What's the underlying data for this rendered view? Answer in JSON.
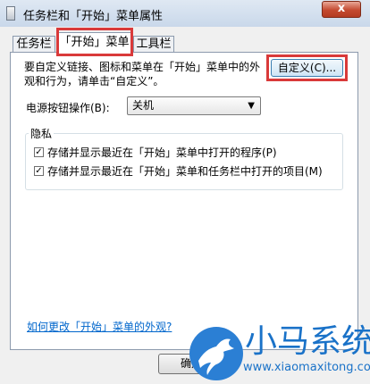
{
  "window": {
    "title": "任务栏和「开始」菜单属性",
    "close_label": "x"
  },
  "tabs": [
    {
      "label": "任务栏",
      "selected": false
    },
    {
      "label": "「开始」菜单",
      "selected": true
    },
    {
      "label": "工具栏",
      "selected": false
    }
  ],
  "start_menu": {
    "description": "要自定义链接、图标和菜单在「开始」菜单中的外观和行为，请单击“自定义”。",
    "customize_label": "自定义(C)...",
    "power_label": "电源按钮操作(B):",
    "power_value": "关机",
    "privacy": {
      "title": "隐私",
      "items": [
        {
          "label": "存储并显示最近在「开始」菜单中打开的程序(P)",
          "checked": true
        },
        {
          "label": "存储并显示最近在「开始」菜单和任务栏中打开的项目(M)",
          "checked": true
        }
      ]
    },
    "help_link": "如何更改「开始」菜单的外观?"
  },
  "buttons": {
    "ok_label": "确定"
  },
  "watermark": {
    "text": "小马系统",
    "url": "www.xiaomaxitong.com"
  },
  "colors": {
    "highlight": "#d93a3a",
    "watermark": "#1a72c8",
    "link": "#0066cc"
  }
}
